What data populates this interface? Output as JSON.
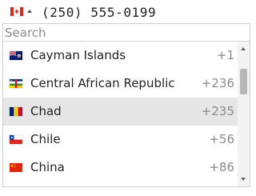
{
  "phone": {
    "selected_country": "Canada",
    "selected_flag_icon": "canada-flag-icon",
    "value": "(250) 555-0199"
  },
  "dropdown": {
    "search_placeholder": "Search",
    "countries": [
      {
        "name": "Cayman Islands",
        "code": "+1",
        "flag_icon": "cayman-islands-flag-icon"
      },
      {
        "name": "Central African Republic",
        "code": "+236",
        "flag_icon": "central-african-republic-flag-icon"
      },
      {
        "name": "Chad",
        "code": "+235",
        "flag_icon": "chad-flag-icon"
      },
      {
        "name": "Chile",
        "code": "+56",
        "flag_icon": "chile-flag-icon"
      },
      {
        "name": "China",
        "code": "+86",
        "flag_icon": "china-flag-icon"
      }
    ],
    "highlighted": "Chad"
  },
  "colors": {
    "highlight_background": "#e6e6e6",
    "code_text": "#8a8a8a",
    "border": "#cfcfcf"
  }
}
